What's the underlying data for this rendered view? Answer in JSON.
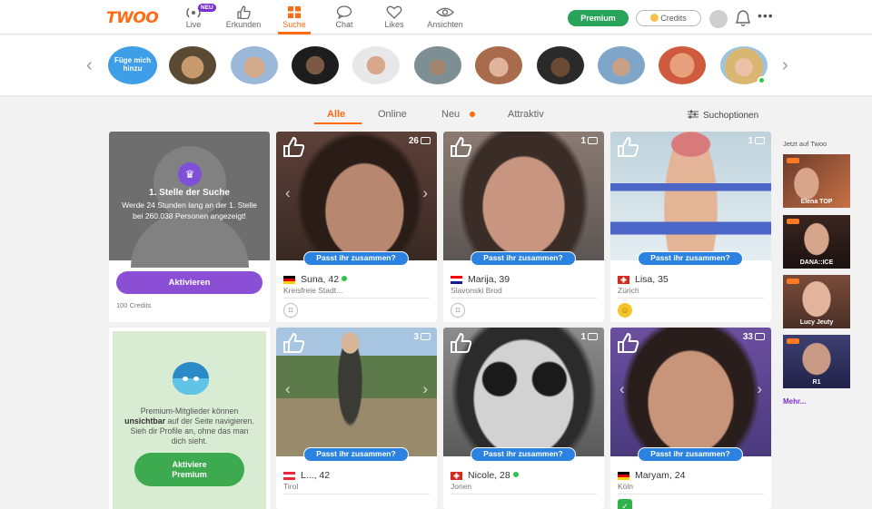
{
  "colors": {
    "brand": "#ff6a13",
    "premium_green": "#27a35a",
    "boost_purple": "#8b4fd6",
    "match_blue": "#2b82e0"
  },
  "header": {
    "logo": "TWOO",
    "nav": [
      {
        "label": "Live",
        "icon": "live-broadcast-icon",
        "badge": "NEU"
      },
      {
        "label": "Erkunden",
        "icon": "thumbs-up-icon"
      },
      {
        "label": "Suche",
        "icon": "grid-icon",
        "active": true
      },
      {
        "label": "Chat",
        "icon": "chat-bubble-icon"
      },
      {
        "label": "Likes",
        "icon": "heart-icon"
      },
      {
        "label": "Ansichten",
        "icon": "eye-icon"
      }
    ],
    "premium_label": "Premium",
    "credits_label": "Credits",
    "more_label": "•••"
  },
  "stories": {
    "add_label": "Füge mich hinzu"
  },
  "filters": {
    "tabs": [
      "Alle",
      "Online",
      "Neu",
      "Attraktiv"
    ],
    "search_options_label": "Suchoptionen"
  },
  "boost": {
    "title": "1. Stelle der Suche",
    "text": "Werde 24 Stunden lang an der 1. Stelle bei 260.038 Personen angezeigt!",
    "button": "Aktivieren",
    "credits": "100 Credits"
  },
  "invisible": {
    "text_pre": "Premium-Mitglieder können ",
    "text_bold": "unsichtbar",
    "text_post": " auf der Seite navigieren. Sieh dir Profile an, ohne das man dich sieht.",
    "button_line1": "Aktiviere",
    "button_line2": "Premium"
  },
  "match_label": "Passt ihr zusammen?",
  "profiles": [
    {
      "name": "Suna, 42",
      "city": "Kreisfreie Stadt...",
      "photos": "26",
      "online": true,
      "country": "de",
      "action": "wink"
    },
    {
      "name": "Marija, 39",
      "city": "Slavonski Brod",
      "photos": "1",
      "online": false,
      "country": "hr",
      "action": "wink"
    },
    {
      "name": "Lisa, 35",
      "city": "Zürich",
      "photos": "1",
      "online": false,
      "country": "ch",
      "action": "smiley"
    },
    {
      "name": "L..., 42",
      "city": "Tirol",
      "photos": "3",
      "online": false,
      "country": "at",
      "action": "none"
    },
    {
      "name": "Nicole, 28",
      "city": "Jonen",
      "photos": "1",
      "online": true,
      "country": "ch",
      "action": "none"
    },
    {
      "name": "Maryam, 24",
      "city": "Köln",
      "photos": "33",
      "online": false,
      "country": "de",
      "action": "check"
    }
  ],
  "right_column": {
    "title": "Jetzt auf Twoo",
    "thumbs": [
      {
        "caption": "Elena TOP"
      },
      {
        "caption": "DANA::ICE"
      },
      {
        "caption": "Lucy Jeuty"
      },
      {
        "caption": "R1"
      }
    ],
    "more_link": "Mehr..."
  }
}
